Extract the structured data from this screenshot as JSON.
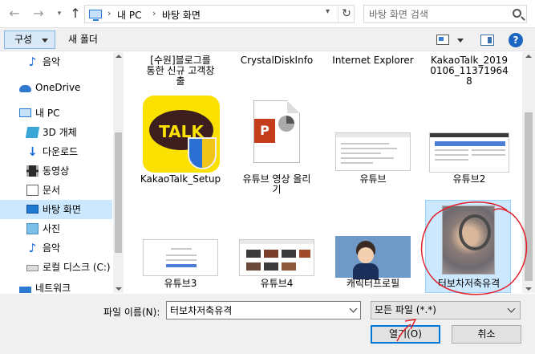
{
  "address_bar": {
    "crumbs": [
      "내 PC",
      "바탕 화면"
    ],
    "separator": "›",
    "search_placeholder": "바탕 화면 검색"
  },
  "toolbar": {
    "organize_label": "구성",
    "new_folder_label": "새 폴더",
    "help_label": "?"
  },
  "nav": {
    "items": [
      {
        "label": "음악",
        "icon": "music-note-icon"
      },
      {
        "label": "OneDrive",
        "icon": "onedrive-cloud-icon"
      },
      {
        "label": "내 PC",
        "icon": "pc-icon"
      },
      {
        "label": "3D 개체",
        "icon": "3d-objects-icon"
      },
      {
        "label": "다운로드",
        "icon": "download-icon"
      },
      {
        "label": "동영상",
        "icon": "video-icon"
      },
      {
        "label": "문서",
        "icon": "document-icon"
      },
      {
        "label": "바탕 화면",
        "icon": "desktop-icon",
        "selected": true
      },
      {
        "label": "사진",
        "icon": "pictures-icon"
      },
      {
        "label": "음악",
        "icon": "music-note-icon"
      },
      {
        "label": "로컬 디스크 (C:)",
        "icon": "local-disk-icon"
      },
      {
        "label": "네트워크",
        "icon": "network-icon"
      }
    ]
  },
  "files": [
    {
      "name": "[수원]블로그를\n통한 신규 고객창\n출"
    },
    {
      "name": "CrystalDiskInfo"
    },
    {
      "name": "Internet Explorer"
    },
    {
      "name": "KakaoTalk_2019\n0106_11371964\n8"
    },
    {
      "name": "KakaoTalk_Setup",
      "kakao_text": "TALK"
    },
    {
      "name": "유튜브 영상 올리\n기",
      "ppt_letter": "P"
    },
    {
      "name": "유튜브"
    },
    {
      "name": "유튜브2"
    },
    {
      "name": "유튜브3"
    },
    {
      "name": "유튜브4"
    },
    {
      "name": "캐릭터프로필"
    },
    {
      "name": "터보차저축유격",
      "selected": true
    }
  ],
  "footer": {
    "filename_label": "파일 이름(N):",
    "filename_value": "터보차저축유격",
    "filetype_value": "모든 파일 (*.*)",
    "open_label": "열기(O)",
    "cancel_label": "취소"
  },
  "colors": {
    "selection": "#cce8ff",
    "accent": "#0078d7",
    "annotation": "#e0202a"
  }
}
